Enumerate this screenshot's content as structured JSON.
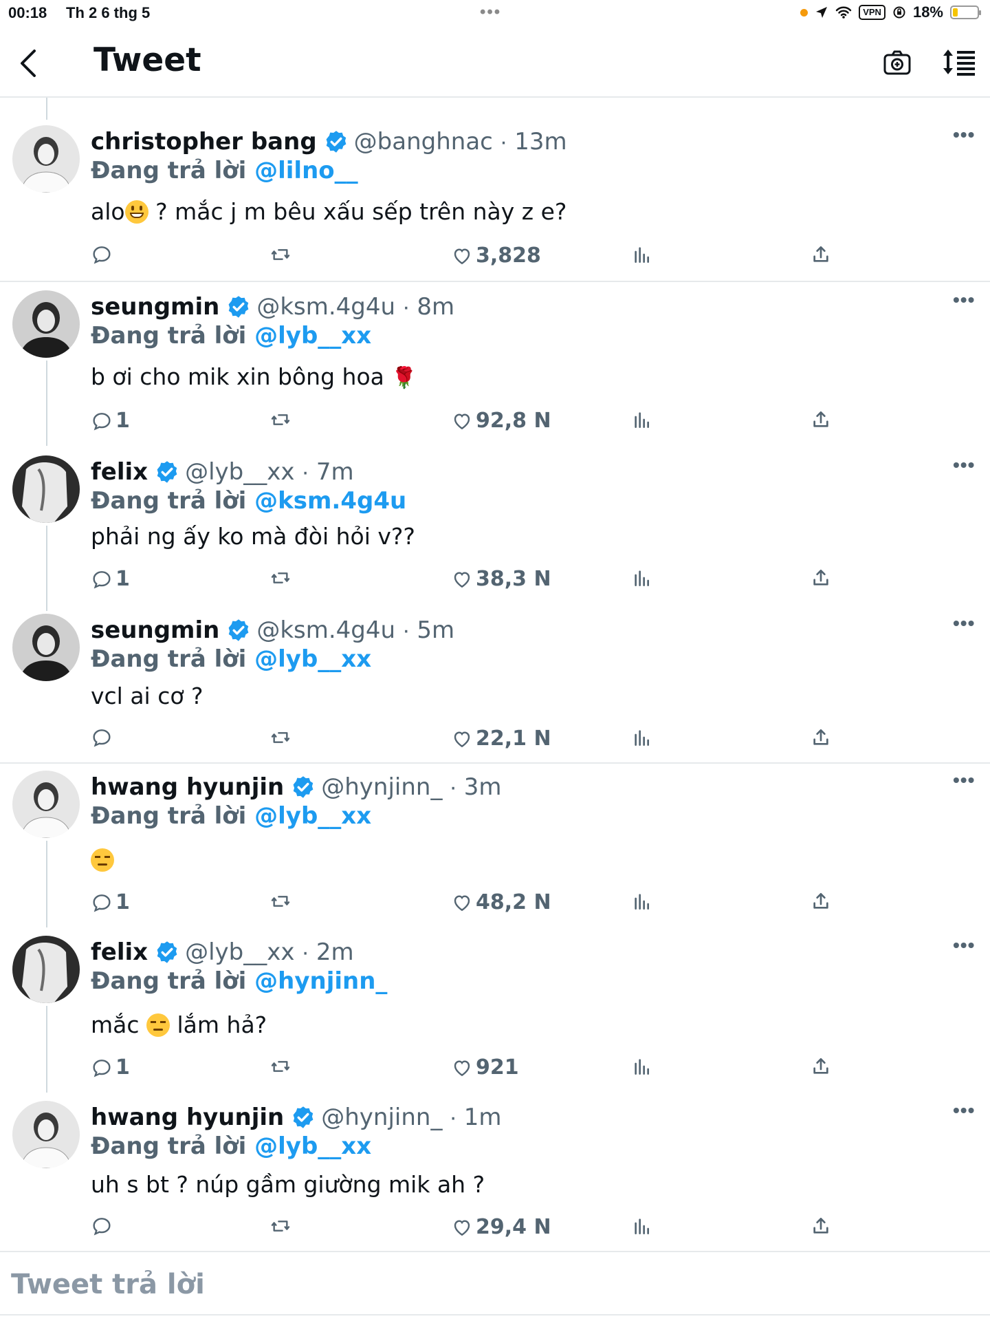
{
  "status_bar": {
    "time": "00:18",
    "date": "Th 2 6 thg 5",
    "multitask_dots": "•••",
    "vpn": "VPN",
    "battery": "18%"
  },
  "nav": {
    "back_icon": "chevron-left-icon",
    "title": "Tweet",
    "camera_icon": "camera-plus-icon",
    "sort_icon": "sort-list-icon"
  },
  "colors": {
    "accent": "#1d9bf0",
    "muted": "#536471",
    "divider": "#e6e9eb"
  },
  "tweets": [
    {
      "name": "christopher bang",
      "handle": "@banghnac",
      "time": "13m",
      "reply_prefix": "Đang trả lời",
      "reply_to": "@lilno__",
      "text_before": "alo",
      "text_after": " ?  mắc j m bêu xấu sếp trên này z e?",
      "replies": "",
      "likes": "3,828"
    },
    {
      "name": "seungmin",
      "handle": "@ksm.4g4u",
      "time": "8m",
      "reply_prefix": "Đang trả lời",
      "reply_to": "@lyb__xx",
      "text": "b ơi cho mik xin bông hoa ",
      "replies": "1",
      "likes": "92,8 N"
    },
    {
      "name": "felix",
      "handle": "@lyb__xx",
      "time": "7m",
      "reply_prefix": "Đang trả lời",
      "reply_to": "@ksm.4g4u",
      "text": "phải ng ấy ko mà đòi hỏi v??",
      "replies": "1",
      "likes": "38,3 N"
    },
    {
      "name": "seungmin",
      "handle": "@ksm.4g4u",
      "time": "5m",
      "reply_prefix": "Đang trả lời",
      "reply_to": "@lyb__xx",
      "text": "vcl ai cơ ?",
      "replies": "",
      "likes": "22,1 N"
    },
    {
      "name": "hwang hyunjin",
      "handle": "@hynjinn_",
      "time": "3m",
      "reply_prefix": "Đang trả lời",
      "reply_to": "@lyb__xx",
      "text": "",
      "replies": "1",
      "likes": "48,2 N"
    },
    {
      "name": "felix",
      "handle": "@lyb__xx",
      "time": "2m",
      "reply_prefix": "Đang trả lời",
      "reply_to": "@hynjinn_",
      "text_before": "mắc ",
      "text_after": " lắm hả?",
      "replies": "1",
      "likes": "921"
    },
    {
      "name": "hwang hyunjin",
      "handle": "@hynjinn_",
      "time": "1m",
      "reply_prefix": "Đang trả lời",
      "reply_to": "@lyb__xx",
      "text": "uh s bt ? núp gầm giường mik ah ?",
      "replies": "",
      "likes": "29,4 N"
    }
  ],
  "composer": {
    "placeholder": "Tweet trả lời"
  }
}
